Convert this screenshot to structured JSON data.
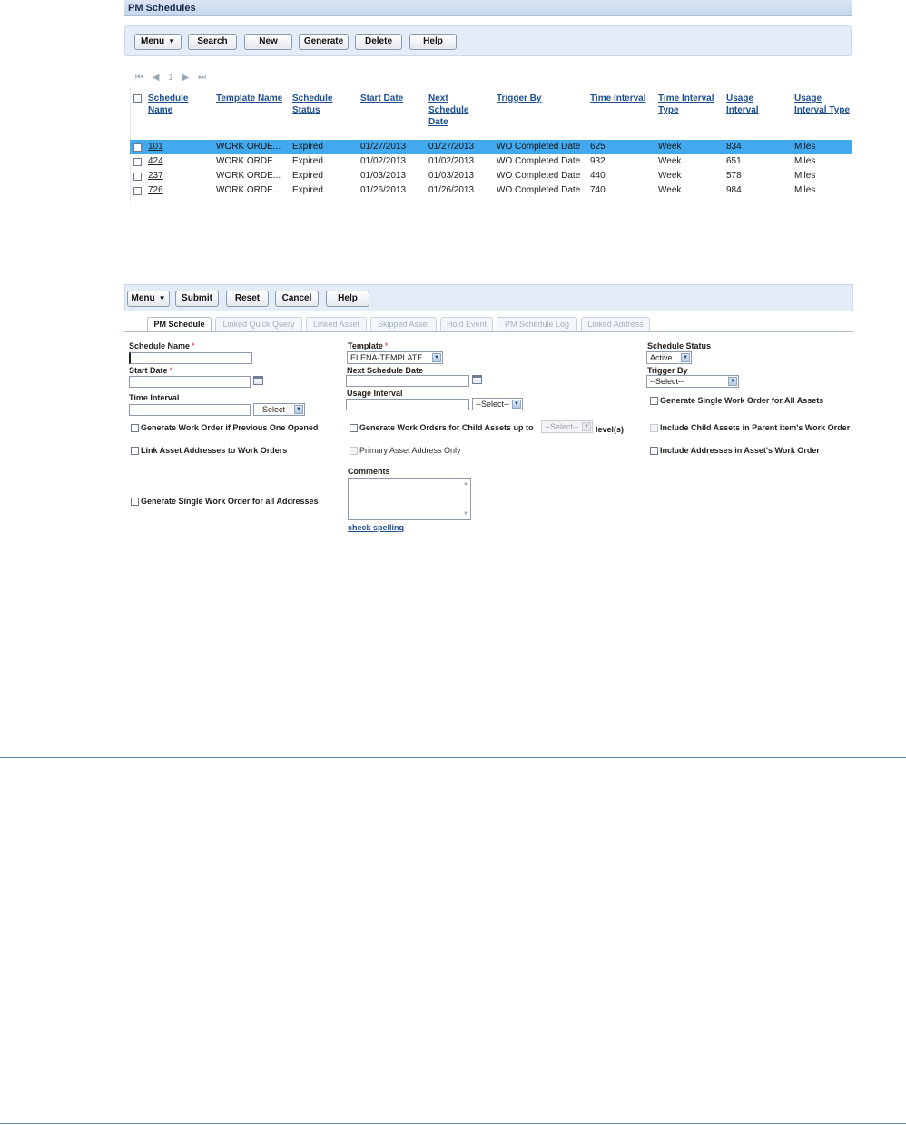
{
  "list_panel": {
    "title": "PM Schedules",
    "toolbar": {
      "menu": "Menu",
      "search": "Search",
      "new": "New",
      "generate": "Generate",
      "delete": "Delete",
      "help": "Help"
    },
    "pager": {
      "first": "⏮",
      "prev": "◀",
      "page": "1",
      "next": "▶",
      "last": "⏭"
    },
    "columns": [
      [
        "Schedule",
        "Name"
      ],
      [
        "Template Name"
      ],
      [
        "Schedule",
        "Status"
      ],
      [
        "Start Date"
      ],
      [
        "Next",
        "Schedule",
        "Date"
      ],
      [
        "Trigger By"
      ],
      [
        "Time Interval"
      ],
      [
        "Time Interval",
        "Type"
      ],
      [
        "Usage",
        "Interval"
      ],
      [
        "Usage",
        "Interval Type"
      ]
    ],
    "rows": [
      {
        "name": "101",
        "template": "WORK ORDE...",
        "status": "Expired",
        "start": "01/27/2013",
        "next": "01/27/2013",
        "trigger": "WO Completed Date",
        "time_interval": "625",
        "time_type": "Week",
        "usage_interval": "834",
        "usage_type": "Miles",
        "selected": true
      },
      {
        "name": "424",
        "template": "WORK ORDE...",
        "status": "Expired",
        "start": "01/02/2013",
        "next": "01/02/2013",
        "trigger": "WO Completed Date",
        "time_interval": "932",
        "time_type": "Week",
        "usage_interval": "651",
        "usage_type": "Miles",
        "selected": false
      },
      {
        "name": "237",
        "template": "WORK ORDE...",
        "status": "Expired",
        "start": "01/03/2013",
        "next": "01/03/2013",
        "trigger": "WO Completed Date",
        "time_interval": "440",
        "time_type": "Week",
        "usage_interval": "578",
        "usage_type": "Miles",
        "selected": false
      },
      {
        "name": "726",
        "template": "WORK ORDE...",
        "status": "Expired",
        "start": "01/26/2013",
        "next": "01/26/2013",
        "trigger": "WO Completed Date",
        "time_interval": "740",
        "time_type": "Week",
        "usage_interval": "984",
        "usage_type": "Miles",
        "selected": false
      }
    ]
  },
  "form_panel": {
    "toolbar": {
      "menu": "Menu",
      "submit": "Submit",
      "reset": "Reset",
      "cancel": "Cancel",
      "help": "Help"
    },
    "tabs": [
      "PM Schedule",
      "Linked Quick Query",
      "Linked Asset",
      "Skipped Asset",
      "Hold Event",
      "PM Schedule Log",
      "Linked Address"
    ],
    "fields": {
      "schedule_name_label": "Schedule Name",
      "start_date_label": "Start Date",
      "time_interval_label": "Time Interval",
      "time_interval_select": "--Select--",
      "template_label": "Template",
      "template_value": "ELENA-TEMPLATE",
      "next_schedule_date_label": "Next Schedule Date",
      "usage_interval_label": "Usage Interval",
      "usage_interval_select": "--Select--",
      "schedule_status_label": "Schedule Status",
      "schedule_status_value": "Active",
      "trigger_by_label": "Trigger By",
      "trigger_by_value": "--Select--",
      "required_mark": "*"
    },
    "checkboxes": {
      "single_wo_all_assets": "Generate Single Work Order for All Assets",
      "wo_if_previous_open": "Generate Work Order if Previous One Opened",
      "wo_child_assets": "Generate Work Orders for Child Assets up to",
      "levels_select": "--Select--",
      "levels_suffix": "level(s)",
      "include_child_assets": "Include Child Assets in Parent item's Work Order",
      "link_asset_addresses": "Link Asset Addresses to Work Orders",
      "primary_asset_address": "Primary Asset Address Only",
      "include_addresses": "Include Addresses in Asset's Work Order",
      "single_wo_all_addresses": "Generate Single Work Order for all Addresses"
    },
    "comments_label": "Comments",
    "check_spelling": "check spelling"
  },
  "colors": {
    "selected_row": "#42a9ef",
    "link": "#1d4f8f",
    "toolbar_bg": "#e3ecf7",
    "rule_line": "#5b8fb9"
  }
}
